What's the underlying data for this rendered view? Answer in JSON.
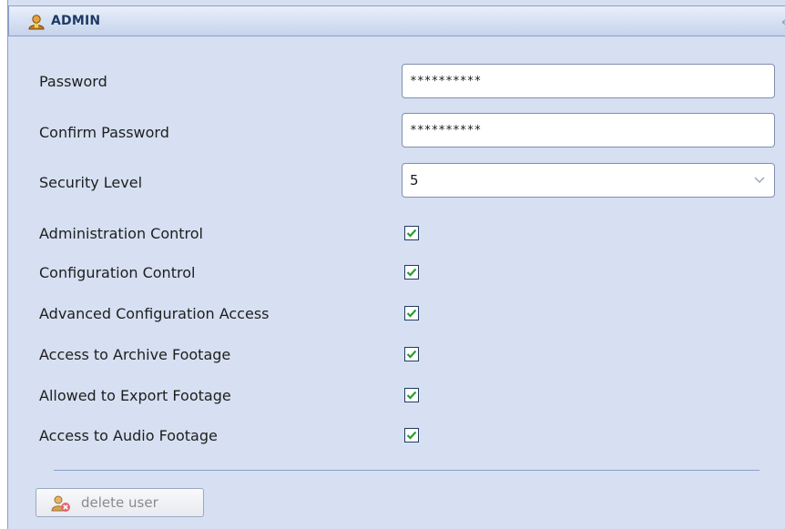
{
  "header": {
    "title": "ADMIN"
  },
  "form": {
    "password": {
      "label": "Password",
      "value": "**********"
    },
    "confirm_password": {
      "label": "Confirm Password",
      "value": "**********"
    },
    "security_level": {
      "label": "Security Level",
      "value": "5"
    },
    "permissions": [
      {
        "label": "Administration Control",
        "checked": true
      },
      {
        "label": "Configuration Control",
        "checked": true
      },
      {
        "label": "Advanced Configuration Access",
        "checked": true
      },
      {
        "label": "Access to Archive Footage",
        "checked": true
      },
      {
        "label": "Allowed to Export Footage",
        "checked": true
      },
      {
        "label": "Access to Audio Footage",
        "checked": true
      }
    ]
  },
  "actions": {
    "delete_label": "delete user"
  },
  "colors": {
    "panel_bg": "#d6e0f2",
    "header_text": "#1f3a66",
    "check_green": "#2e9b2e"
  }
}
